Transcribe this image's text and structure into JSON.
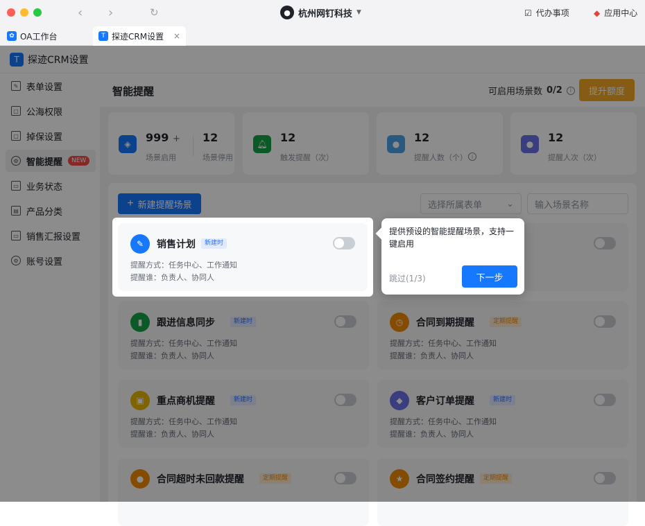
{
  "window": {
    "org_name": "杭州网钉科技",
    "todo_label": "代办事项",
    "app_center_label": "应用中心"
  },
  "tabs": [
    {
      "label": "OA工作台",
      "active": false
    },
    {
      "label": "探迹CRM设置",
      "active": true
    }
  ],
  "app": {
    "title": "探迹CRM设置"
  },
  "sidebar": {
    "items": [
      {
        "label": "表单设置"
      },
      {
        "label": "公海权限"
      },
      {
        "label": "掉保设置"
      },
      {
        "label": "智能提醒",
        "badge": "NEW",
        "active": true
      },
      {
        "label": "业务状态"
      },
      {
        "label": "产品分类"
      },
      {
        "label": "销售汇报设置"
      },
      {
        "label": "账号设置"
      }
    ]
  },
  "page": {
    "title": "智能提醒",
    "quota_label": "可启用场景数",
    "quota_value": "0/2",
    "upgrade_label": "提升额度"
  },
  "stats": [
    {
      "num1": "999",
      "num1_suffix": "+",
      "label1": "场景启用",
      "num2": "12",
      "label2": "场景停用",
      "color": "#1677ff"
    },
    {
      "num1": "12",
      "label1": "触发提醒（次）",
      "color": "#16a34a"
    },
    {
      "num1": "12",
      "label1": "提醒人数（个）",
      "color": "#4ba3e8"
    },
    {
      "num1": "12",
      "label1": "提醒人次（次）",
      "color": "#6b6fe6"
    }
  ],
  "toolbar": {
    "new_label": "新建提醒场景",
    "form_select": "选择所属表单",
    "search_placeholder": "输入场景名称"
  },
  "cards": [
    {
      "title": "销售计划",
      "badge": "新建时",
      "badge_type": "blue",
      "method": "提醒方式：任务中心、工作通知",
      "who": "提醒谁：负责人、协同人",
      "color": "#1677ff"
    },
    {
      "title": "",
      "badge": "",
      "badge_type": "orange",
      "method": "",
      "who": "",
      "color": "#f5a623"
    },
    {
      "title": "跟进信息同步",
      "badge": "新建时",
      "badge_type": "blue",
      "method": "提醒方式：任务中心、工作通知",
      "who": "提醒谁：负责人、协同人",
      "color": "#16a34a"
    },
    {
      "title": "合同到期提醒",
      "badge": "定期提醒",
      "badge_type": "orange",
      "method": "提醒方式：任务中心、工作通知",
      "who": "提醒谁：负责人、协同人",
      "color": "#f08a00"
    },
    {
      "title": "重点商机提醒",
      "badge": "新建时",
      "badge_type": "blue",
      "method": "提醒方式：任务中心、工作通知",
      "who": "提醒谁：负责人、协同人",
      "color": "#e8b400"
    },
    {
      "title": "客户订单提醒",
      "badge": "新建时",
      "badge_type": "blue",
      "method": "提醒方式：任务中心、工作通知",
      "who": "提醒谁：负责人、协同人",
      "color": "#6b6fe6"
    },
    {
      "title": "合同超时未回款提醒",
      "badge": "定期提醒",
      "badge_type": "orange",
      "method": "",
      "who": "",
      "color": "#f08a00"
    },
    {
      "title": "合同签约提醒",
      "badge": "定期提醒",
      "badge_type": "orange",
      "method": "",
      "who": "",
      "color": "#f08a00"
    }
  ],
  "guide": {
    "text": "提供预设的智能提醒场景，支持一键启用",
    "skip_label": "跳过(1/3)",
    "next_label": "下一步"
  }
}
